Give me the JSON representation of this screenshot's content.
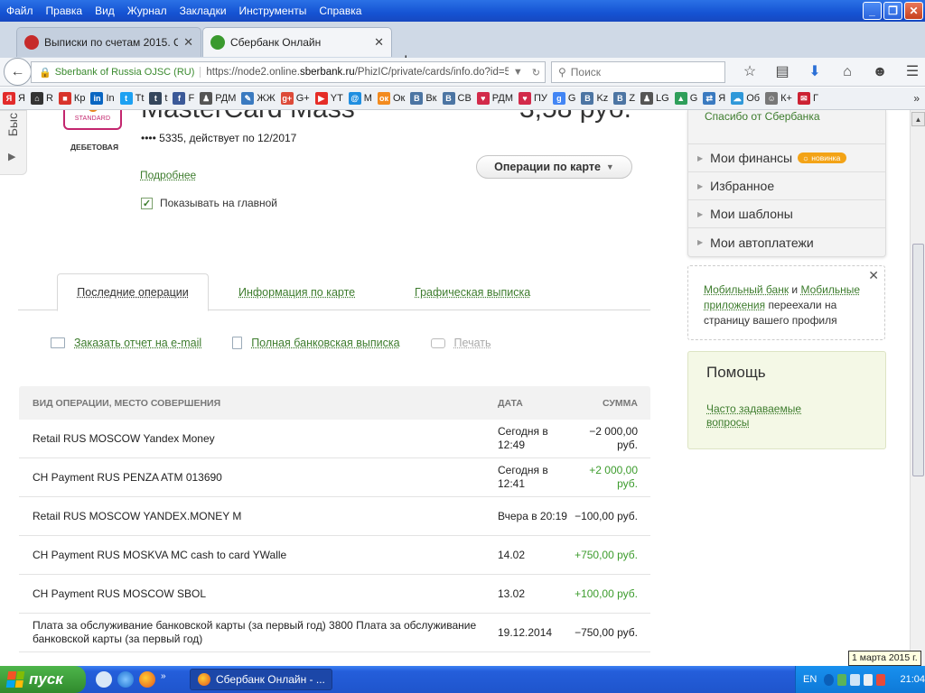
{
  "browser": {
    "menu": [
      "Файл",
      "Правка",
      "Вид",
      "Журнал",
      "Закладки",
      "Инструменты",
      "Справка"
    ],
    "window_controls": {
      "minimize": "_",
      "maximize": "❐",
      "close": "✕"
    },
    "tabs": [
      {
        "title": "Выписки по счетам 2015. Сб...",
        "active": false,
        "favicon_color": "#c62a2a"
      },
      {
        "title": "Сбербанк Онлайн",
        "active": true,
        "favicon_color": "#3a9a2e"
      }
    ],
    "new_tab_label": "+",
    "identity": "Sberbank of Russia  OJSC (RU)",
    "url_prefix": "https://node2.online.",
    "url_domain": "sberbank.ru",
    "url_suffix": "/PhizIC/private/cards/info.do?id=52818",
    "search_placeholder": "Поиск",
    "bookmarks": [
      {
        "label": "Я",
        "icon_color": "#e22b2b",
        "glyph": "Я"
      },
      {
        "label": "R",
        "icon_color": "#333333",
        "glyph": "⌂"
      },
      {
        "label": "Кр",
        "icon_color": "#d8342b",
        "glyph": "■"
      },
      {
        "label": "In",
        "icon_color": "#0a66c2",
        "glyph": "in"
      },
      {
        "label": "Tt",
        "icon_color": "#1da1f2",
        "glyph": "t"
      },
      {
        "label": "t",
        "icon_color": "#35465c",
        "glyph": "t"
      },
      {
        "label": "F",
        "icon_color": "#3b5998",
        "glyph": "f"
      },
      {
        "label": "РДМ",
        "icon_color": "#555555",
        "glyph": "♟"
      },
      {
        "label": "ЖЖ",
        "icon_color": "#3a7ac0",
        "glyph": "✎"
      },
      {
        "label": "G+",
        "icon_color": "#dd4b39",
        "glyph": "g+"
      },
      {
        "label": "YT",
        "icon_color": "#e52d27",
        "glyph": "▶"
      },
      {
        "label": "М",
        "icon_color": "#1f8ee0",
        "glyph": "@"
      },
      {
        "label": "Ок",
        "icon_color": "#f38b1f",
        "glyph": "ок"
      },
      {
        "label": "Вк",
        "icon_color": "#4c75a3",
        "glyph": "В"
      },
      {
        "label": "СВ",
        "icon_color": "#4c75a3",
        "glyph": "В"
      },
      {
        "label": "РДМ",
        "icon_color": "#d22a4a",
        "glyph": "♥"
      },
      {
        "label": "ПУ",
        "icon_color": "#d22a4a",
        "glyph": "♥"
      },
      {
        "label": "G",
        "icon_color": "#4285f4",
        "glyph": "g"
      },
      {
        "label": "Kz",
        "icon_color": "#4c75a3",
        "glyph": "В"
      },
      {
        "label": "Z",
        "icon_color": "#4c75a3",
        "glyph": "В"
      },
      {
        "label": "LG",
        "icon_color": "#555555",
        "glyph": "♟"
      },
      {
        "label": "G",
        "icon_color": "#2e9e5a",
        "glyph": "▲"
      },
      {
        "label": "Я",
        "icon_color": "#3a7ac0",
        "glyph": "⇄"
      },
      {
        "label": "Об",
        "icon_color": "#2f98d9",
        "glyph": "☁"
      },
      {
        "label": "К+",
        "icon_color": "#777777",
        "glyph": "☺"
      },
      {
        "label": "Г",
        "icon_color": "#cc2233",
        "glyph": "✉"
      }
    ],
    "bookmarks_more": "»"
  },
  "page": {
    "side_slider_label": "Быс",
    "card": {
      "logo_text": "STANDARD",
      "type": "ДЕБЕТОВАЯ",
      "title": "MasterCard Mass",
      "balance": "3,58 руб.",
      "number_line": "•••• 5335, действует по 12/2017",
      "more_link": "Подробнее",
      "ops_button": "Операции по карте",
      "show_main_label": "Показывать на главной",
      "show_main_checked": true
    },
    "tabs": [
      {
        "label": "Последние операции",
        "active": true
      },
      {
        "label": "Информация по карте",
        "active": false
      },
      {
        "label": "Графическая выписка",
        "active": false
      }
    ],
    "actions": [
      {
        "label": "Заказать отчет на e-mail",
        "enabled": true
      },
      {
        "label": "Полная банковская выписка",
        "enabled": true
      },
      {
        "label": "Печать",
        "enabled": false
      }
    ],
    "table": {
      "headers": {
        "name": "ВИД ОПЕРАЦИИ, МЕСТО СОВЕРШЕНИЯ",
        "date": "ДАТА",
        "sum": "СУММА"
      },
      "rows": [
        {
          "name": "Retail RUS MOSCOW Yandex Money",
          "date": "Сегодня в 12:49",
          "sum": "−2 000,00 руб.",
          "positive": false
        },
        {
          "name": "CH Payment RUS PENZA ATM 013690",
          "date": "Сегодня в 12:41",
          "sum": "+2 000,00 руб.",
          "positive": true
        },
        {
          "name": "Retail RUS MOSCOW YANDEX.MONEY M",
          "date": "Вчера в 20:19",
          "sum": "−100,00 руб.",
          "positive": false
        },
        {
          "name": "CH Payment RUS MOSKVA MC cash to card YWalle",
          "date": "14.02",
          "sum": "+750,00 руб.",
          "positive": true
        },
        {
          "name": "CH Payment RUS MOSCOW SBOL",
          "date": "13.02",
          "sum": "+100,00 руб.",
          "positive": true
        },
        {
          "name": "Плата за обслуживание банковской карты (за первый год) 3800 Плата за обслуживание банковской карты (за первый год)",
          "date": "19.12.2014",
          "sum": "−750,00 руб.",
          "positive": false
        }
      ]
    },
    "sidebar": {
      "top_link": "Спасибо от Сбербанка",
      "items": [
        {
          "label": "Мои финансы",
          "badge": "новинка"
        },
        {
          "label": "Избранное",
          "badge": ""
        },
        {
          "label": "Мои шаблоны",
          "badge": ""
        },
        {
          "label": "Мои автоплатежи",
          "badge": ""
        }
      ],
      "notice": {
        "link1": "Мобильный банк",
        "and": "и",
        "link2": "Мобильные приложения",
        "text": "переехали на страницу вашего профиля",
        "close": "✕"
      },
      "help": {
        "title": "Помощь",
        "link": "Часто задаваемые вопросы"
      }
    }
  },
  "date_tooltip": "1 марта 2015 г.",
  "taskbar": {
    "start": "пуск",
    "quick_more": "»",
    "active_window": "Сбербанк Онлайн - ...",
    "lang": "EN",
    "clock": "21:04"
  },
  "colors": {
    "sber_green": "#3d7c2d",
    "positive_amount": "#3d9c2d",
    "xp_blue": "#245edb",
    "badge_orange": "#f3a316"
  }
}
